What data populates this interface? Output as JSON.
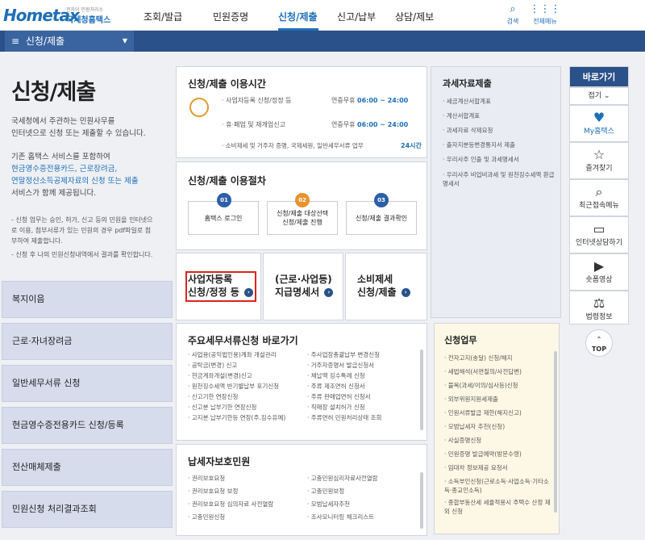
{
  "header": {
    "logo_text": "Hometax",
    "logo_sub": "국세청홈택스",
    "logo_tiny": "전자이 민원처리소",
    "nav": [
      "조회/발급",
      "민원증명",
      "신청/제출",
      "신고/납부",
      "상담/제보"
    ],
    "search": "검색",
    "allmenu": "전체메뉴"
  },
  "breadcrumb": {
    "menu_icon": "≡",
    "label": "신청/제출",
    "caret": "▼"
  },
  "left": {
    "title": "신청/제출",
    "p1a": "국세청에서 주관하는 민원사무를",
    "p1b": "인터넷으로 신청 또는 제출할 수 있습니다.",
    "p2a": "기존 홈택스 서비스를 포함하여",
    "p2b": "현금영수증전용카드, 근로장려금,",
    "p2c": "연말정산소득공제자료의 신청 또는 제출",
    "p2d": "서비스가 함께 제공됩니다.",
    "n1a": "- 신청 업무는 승인, 허가, 신고 등의 민원을 인터넷으",
    "n1b": "로 이용, 첨부서류가 있는 민원의 경우 pdf파일로 첨",
    "n1c": "부하여 제출합니다.",
    "n2": "- 신청 후 나의 민원신청내역에서 결과를 확인합니다.",
    "nav": [
      "복지이음",
      "근로·자녀장려금",
      "일반세무서류 신청",
      "현금영수증전용카드 신청/등록",
      "전산매체제출",
      "민원신청 처리결과조회"
    ]
  },
  "hours": {
    "title": "신청/제출 이용시간",
    "rows": [
      {
        "label": "· 사업자등록 신청/정정 등",
        "type": "연중무휴",
        "time": "06:00 ~ 24:00"
      },
      {
        "label": "· 휴·폐업 및 재개업신고",
        "type": "연중무휴",
        "time": "06:00 ~ 24:00"
      },
      {
        "label": "· 소비제세 및 거주자 증명, 국제세원, 일반세무서류 업무",
        "type": "",
        "time": "24시간"
      }
    ]
  },
  "steps": {
    "title": "신청/제출 이용절차",
    "items": [
      {
        "n": "01",
        "a": "홈택스 로그인",
        "b": ""
      },
      {
        "n": "02",
        "a": "신청/제출 대상선택",
        "b": "신청/제출 진행"
      },
      {
        "n": "03",
        "a": "신청/제출 결과확인",
        "b": ""
      }
    ]
  },
  "buttons": [
    {
      "a": "사업자등록",
      "b": "신청/정정 등"
    },
    {
      "a": "(근로·사업등)",
      "b": "지급명세서"
    },
    {
      "a": "소비제세",
      "b": "신청/제출"
    }
  ],
  "docs": {
    "title": "과세자료제출",
    "items": [
      "세금계산서합계표",
      "계산서합계표",
      "과세자료 삭제요청",
      "출자지분등변경통지서 제출",
      "우리사주 인출 및 과세명세서",
      "우리사주 비업비과세 및 원천징수세액 환급명세서"
    ]
  },
  "shortcuts": {
    "title": "주요세무서류신청 바로가기",
    "col1": [
      "사업용(공익법인용)계좌 개설관리",
      "공탁금(변경) 신고",
      "현금계좌개설(변경)신고",
      "원천징수세액 반기별납부 포기신청",
      "신고기한 연장신청",
      "신고분 납부기한 연장신청",
      "고지분 납부기한등 연장(주.징수유예)"
    ],
    "col2": [
      "주사업장총괄납부 변경신청",
      "거주자증명서 발급신청서",
      "체납액 징수특례 신청",
      "주류 제조면허 신청서",
      "주류 판매업면허 신청서",
      "직매장 설치허가 신청",
      "주류면허 민원처리상태 조회"
    ]
  },
  "business": {
    "title": "신청업무",
    "items": [
      "전자고지(송달) 신청/해지",
      "세법해석(서면질의/사전답변)",
      "불복(과세/이의/심사등)신청",
      "외부위원지원세제출",
      "인원서류발급 제한(해지신고)",
      "모범납세자 추천(신청)",
      "사실증명신청",
      "민원증명 발급예약(방문수령)",
      "임대차 정보제공 요청서",
      "소득부인신청(근로소득·사업소득·기타소득·종교인소득)",
      "종합부동산세 세율적용시 주택수 산정 제외 신청"
    ]
  },
  "protect": {
    "title": "납세자보호민원",
    "col1": [
      "권리보호요청",
      "권리보호요청 보정",
      "권리보호요청 심의자료 사전열람",
      "고충민원신청"
    ],
    "col2": [
      "고충민원심리자료사전열람",
      "고충민원보정",
      "모범납세자추천",
      "조사모니터링 체크리스트"
    ]
  },
  "quick": {
    "title": "바로가기",
    "collapse": "접기",
    "items": [
      {
        "icon": "♥",
        "label": "My홈택스"
      },
      {
        "icon": "☆",
        "label": "즐겨찾기"
      },
      {
        "icon": "⌕",
        "label": "최근접속메뉴"
      },
      {
        "icon": "▭",
        "label": "인터넷상담하기"
      },
      {
        "icon": "▶",
        "label": "숏폼영상"
      },
      {
        "icon": "⚖",
        "label": "법령정보"
      }
    ],
    "top": "TOP"
  }
}
